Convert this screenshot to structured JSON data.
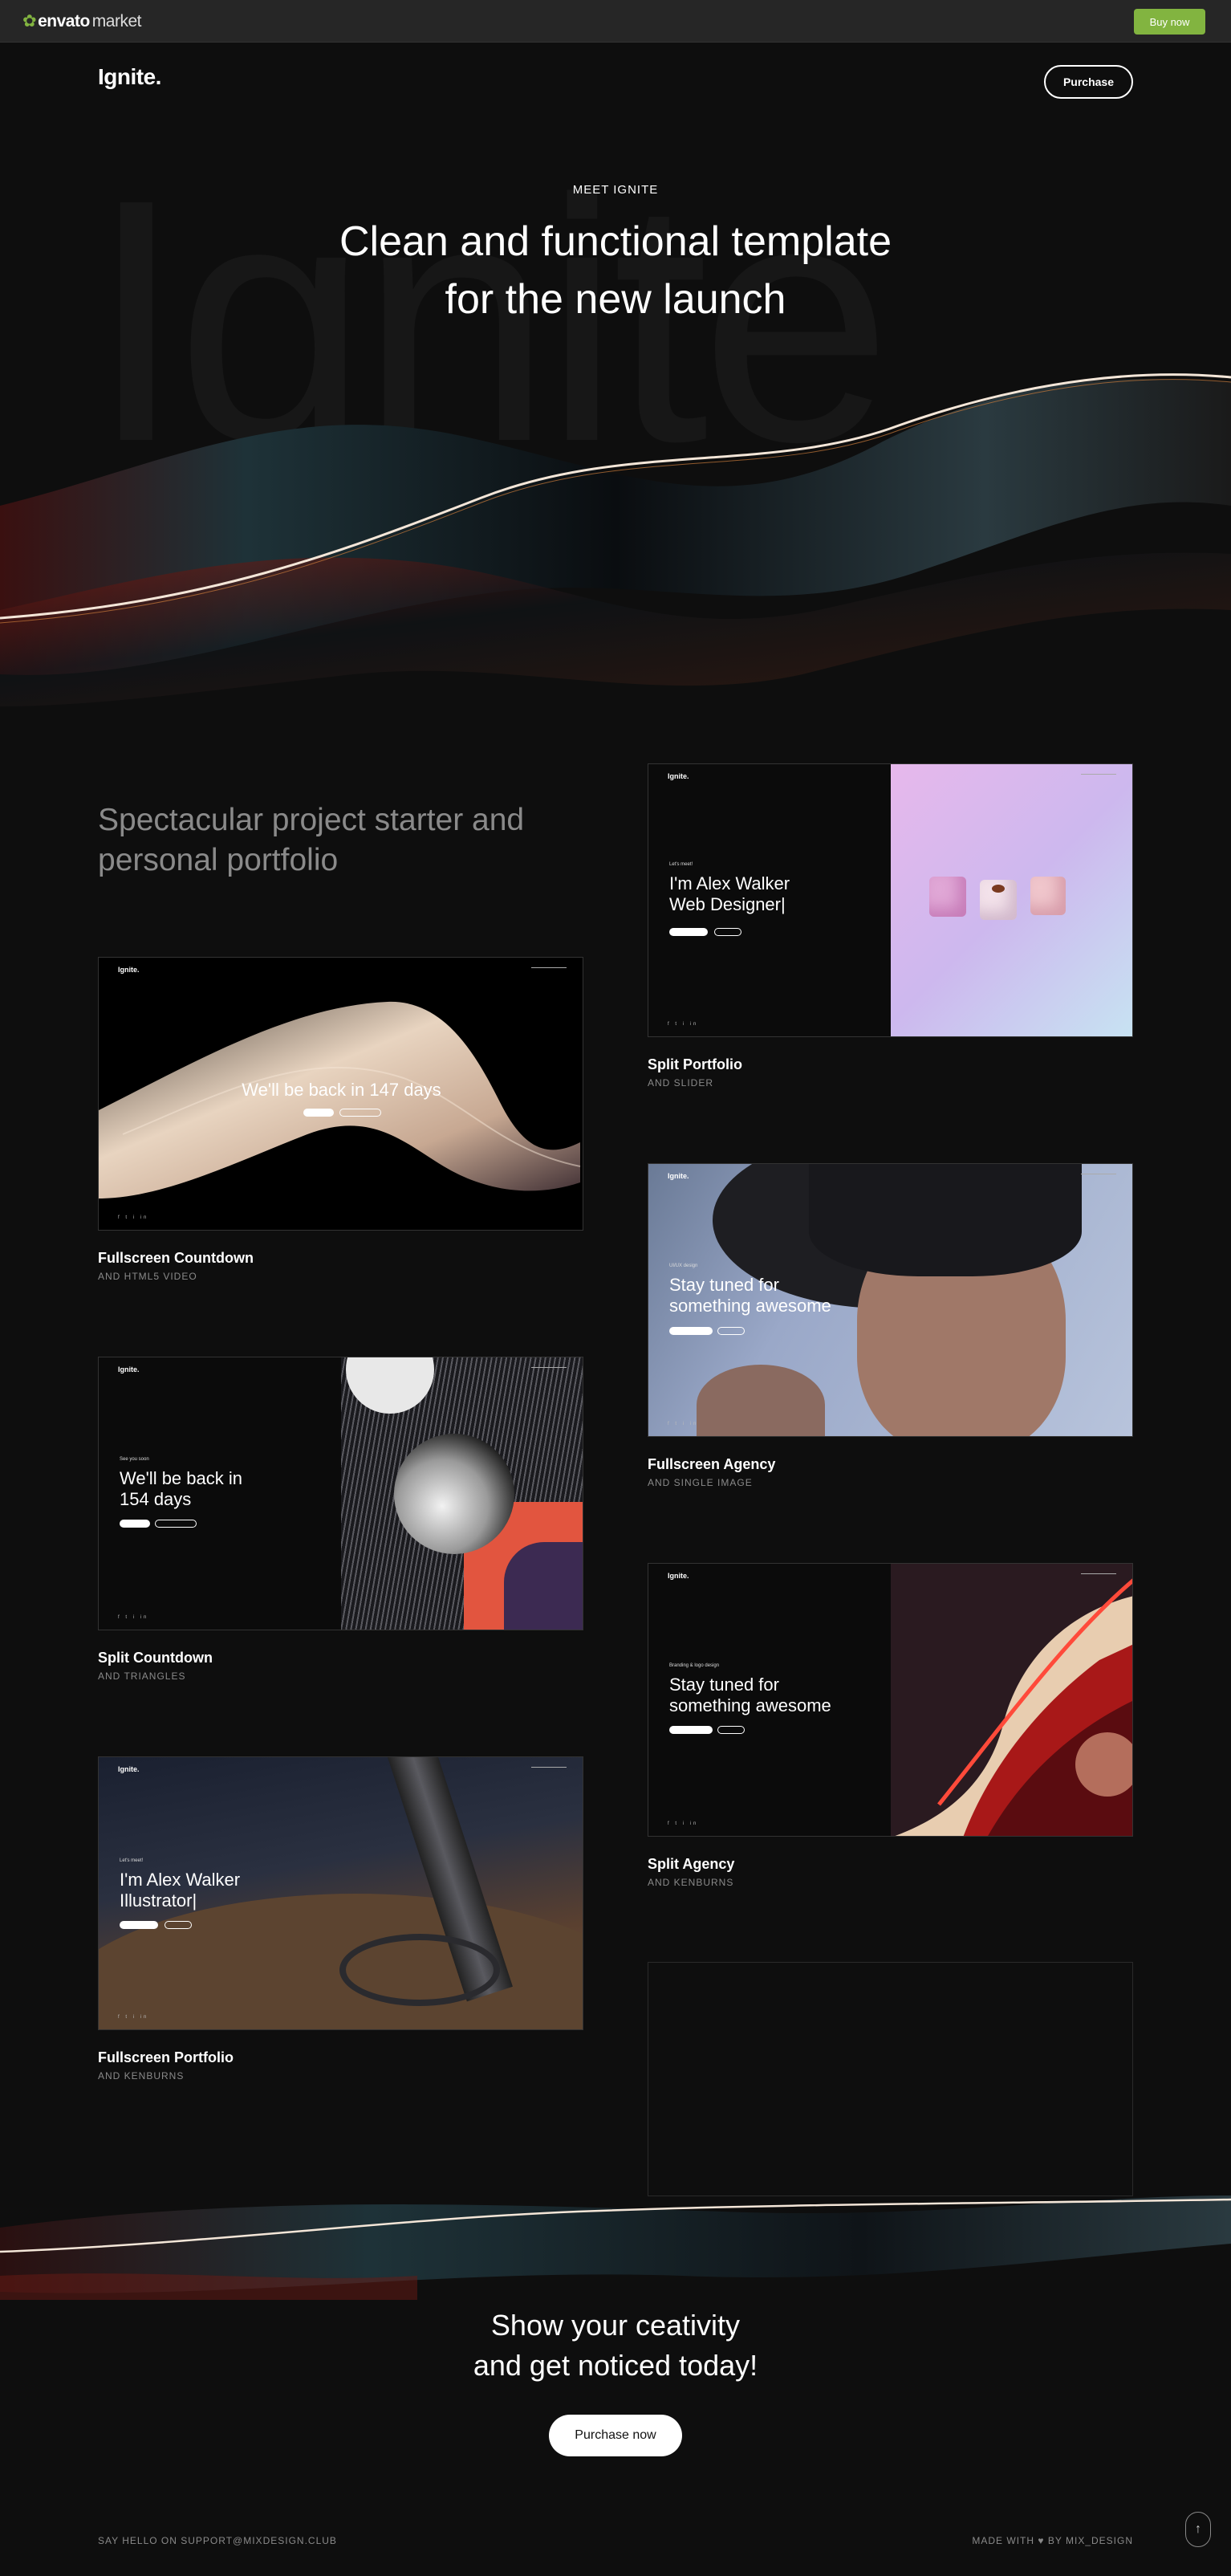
{
  "topbar": {
    "brand": "envato",
    "brand_suffix": "market",
    "buy_label": "Buy now",
    "accent": "#82b440"
  },
  "header": {
    "logo": "Ignite.",
    "purchase_label": "Purchase"
  },
  "hero": {
    "bg_word": "Ignite",
    "eyebrow": "MEET IGNITE",
    "title_line1": "Clean and functional template",
    "title_line2": "for the new launch"
  },
  "intro": {
    "line1": "Spectacular project starter and",
    "line2": "personal portfolio"
  },
  "demos": [
    {
      "title": "Split Portfolio",
      "subtitle": "AND SLIDER",
      "logo": "Ignite.",
      "eyebrow": "Let's meet!",
      "heading1": "I'm Alex Walker",
      "heading2": "Web Designer|"
    },
    {
      "title": "Fullscreen Countdown",
      "subtitle": "AND HTML5 VIDEO",
      "logo": "Ignite.",
      "heading1": "We'll be back in 147 days"
    },
    {
      "title": "Fullscreen Agency",
      "subtitle": "AND SINGLE IMAGE",
      "logo": "Ignite.",
      "eyebrow": "UI/UX design",
      "heading1": "Stay tuned for",
      "heading2": "something awesome"
    },
    {
      "title": "Split Countdown",
      "subtitle": "AND TRIANGLES",
      "logo": "Ignite.",
      "eyebrow": "See you soon",
      "heading1": "We'll be back in",
      "heading2": "154 days"
    },
    {
      "title": "Split Agency",
      "subtitle": "AND KENBURNS",
      "logo": "Ignite.",
      "eyebrow": "Branding & logo design",
      "heading1": "Stay tuned for",
      "heading2": "something awesome"
    },
    {
      "title": "Fullscreen Portfolio",
      "subtitle": "AND KENBURNS",
      "logo": "Ignite.",
      "eyebrow": "Let's meet!",
      "heading1": "I'm Alex Walker",
      "heading2": "Illustrator|"
    }
  ],
  "cta": {
    "line1": "Show your ceativity",
    "line2": "and get noticed today!",
    "button": "Purchase now"
  },
  "footer": {
    "left": "SAY HELLO ON SUPPORT@MIXDESIGN.CLUB",
    "right_pre": "MADE WITH",
    "right_post": "BY MIX_DESIGN"
  }
}
